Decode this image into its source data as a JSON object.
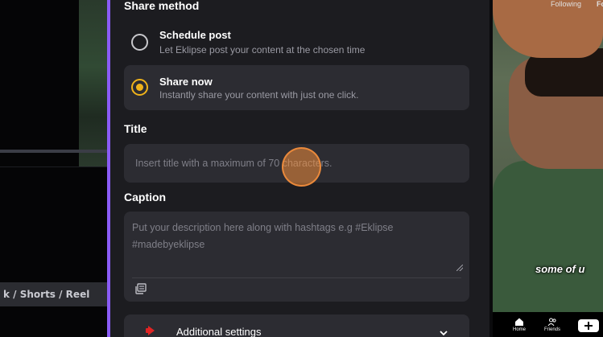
{
  "editor": {
    "format_chip_label": "k / Shorts / Reels"
  },
  "share": {
    "section_label": "Share method",
    "options": [
      {
        "title": "Schedule post",
        "description": "Let Eklipse post your content at the chosen time",
        "selected": false
      },
      {
        "title": "Share now",
        "description": "Instantly share your content with just one click.",
        "selected": true
      }
    ],
    "accent_color": "#f0b31a"
  },
  "title_field": {
    "label": "Title",
    "placeholder": "Insert title with a maximum of 70 characters.",
    "value": ""
  },
  "caption_field": {
    "label": "Caption",
    "placeholder": "Put your description here along with hashtags e.g #Eklipse #madebyeklipse",
    "value": ""
  },
  "additional_settings": {
    "label": "Additional settings",
    "icon": "youtube-icon",
    "expand_icon": "chevron-down-icon"
  },
  "preview": {
    "top_tabs": [
      "Following",
      "Fo"
    ],
    "caption_overlay": "some of u",
    "bottom_tabs": [
      {
        "label": "Home",
        "icon": "home-icon"
      },
      {
        "label": "Friends",
        "icon": "friends-icon"
      }
    ],
    "create_icon": "plus-icon"
  },
  "theme": {
    "panel_border": "#8a5cf6",
    "panel_bg": "#1c1c20",
    "field_bg": "#2c2c32"
  }
}
